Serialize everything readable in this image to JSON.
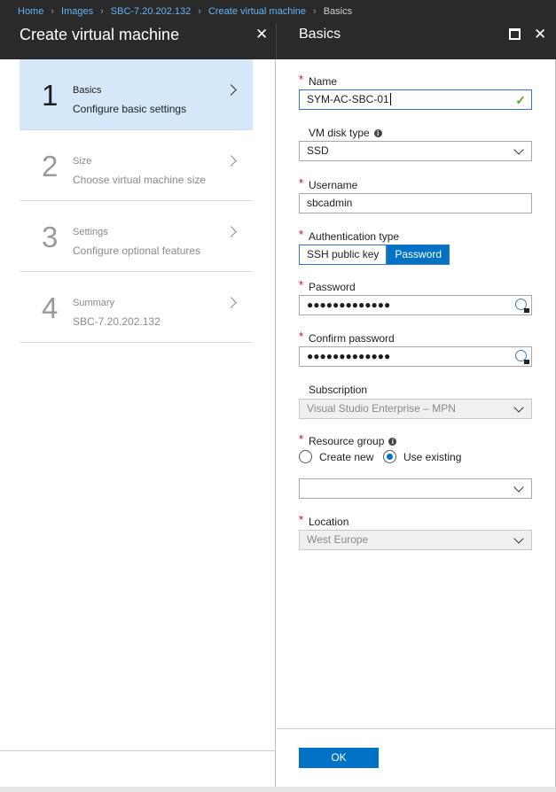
{
  "breadcrumb": {
    "items": [
      "Home",
      "Images",
      "SBC-7.20.202.132",
      "Create virtual machine",
      "Basics"
    ]
  },
  "left_blade": {
    "title": "Create virtual machine",
    "close_icon": "close-icon",
    "steps": [
      {
        "number": "1",
        "title": "Basics",
        "subtitle": "Configure basic settings",
        "active": true
      },
      {
        "number": "2",
        "title": "Size",
        "subtitle": "Choose virtual machine size",
        "active": false
      },
      {
        "number": "3",
        "title": "Settings",
        "subtitle": "Configure optional features",
        "active": false
      },
      {
        "number": "4",
        "title": "Summary",
        "subtitle": "SBC-7.20.202.132",
        "active": false
      }
    ]
  },
  "right_blade": {
    "title": "Basics",
    "maximize_icon": "maximize-icon",
    "close_icon": "close-icon"
  },
  "form": {
    "name": {
      "label": "Name",
      "required": true,
      "value": "SYM-AC-SBC-01",
      "valid": true
    },
    "vm_disk_type": {
      "label": "VM disk type",
      "value": "SSD"
    },
    "username": {
      "label": "Username",
      "required": true,
      "value": "sbcadmin"
    },
    "auth_type": {
      "label": "Authentication type",
      "required": true,
      "options": [
        "SSH public key",
        "Password"
      ],
      "selected": "Password"
    },
    "password": {
      "label": "Password",
      "required": true,
      "masked": "●●●●●●●●●●●●●"
    },
    "confirm_password": {
      "label": "Confirm password",
      "required": true,
      "masked": "●●●●●●●●●●●●●"
    },
    "subscription": {
      "label": "Subscription",
      "value": "Visual Studio Enterprise – MPN"
    },
    "resource_group": {
      "label": "Resource group",
      "required": true,
      "options": [
        "Create new",
        "Use existing"
      ],
      "selected": "Use existing",
      "value": ""
    },
    "location": {
      "label": "Location",
      "required": true,
      "value": "West Europe"
    }
  },
  "ok_label": "OK",
  "colors": {
    "accent": "#0072c6",
    "header": "#2a2a2a",
    "active_step": "#d4e8f9",
    "link": "#64b5f6"
  }
}
